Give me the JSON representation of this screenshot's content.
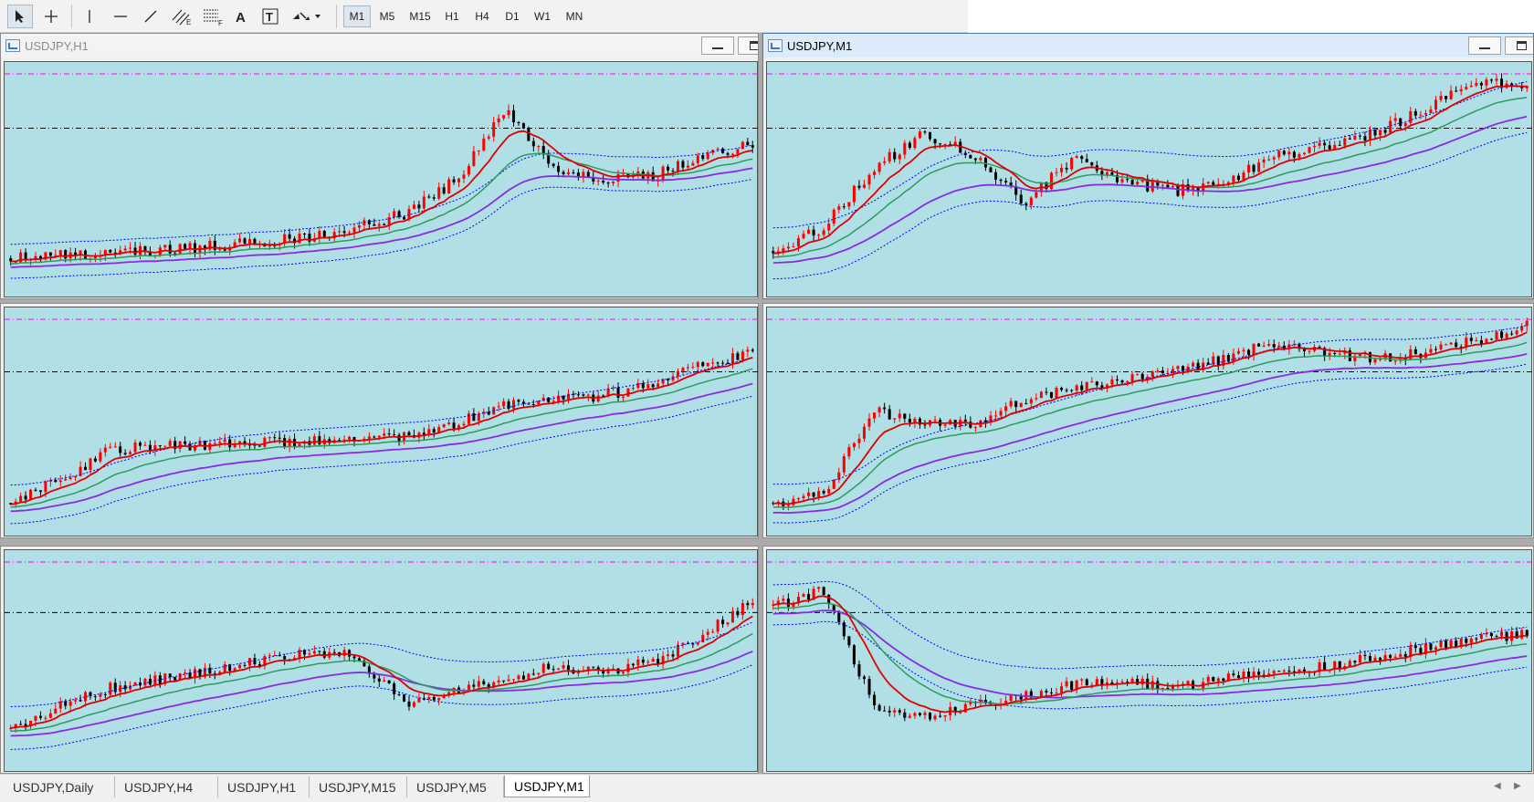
{
  "toolbar": {
    "tools": [
      {
        "name": "cursor-icon"
      },
      {
        "name": "crosshair-icon"
      },
      {
        "name": "vertical-line-icon"
      },
      {
        "name": "horizontal-line-icon"
      },
      {
        "name": "trendline-icon"
      },
      {
        "name": "equidistant-channel-icon",
        "label": "E"
      },
      {
        "name": "fibonacci-retracement-icon",
        "label": "F"
      },
      {
        "name": "text-tool-icon",
        "label": "A"
      },
      {
        "name": "text-label-icon",
        "label": "T"
      },
      {
        "name": "arrows-dropdown-icon"
      }
    ],
    "timeframes": [
      "M1",
      "M5",
      "M15",
      "H1",
      "H4",
      "D1",
      "W1",
      "MN"
    ],
    "active_timeframe": "M1"
  },
  "windows": [
    {
      "title": "USDJPY,H1",
      "active": false
    },
    {
      "title": "USDJPY,M1",
      "active": true
    }
  ],
  "tabs": [
    "USDJPY,Daily",
    "USDJPY,H4",
    "USDJPY,H1",
    "USDJPY,M15",
    "USDJPY,M5",
    "USDJPY,M1"
  ],
  "active_tab": "USDJPY,M1",
  "colors": {
    "chart_bg": "#b0e0e6",
    "bull_candle": "#ff0000",
    "bear_candle": "#000000",
    "ma_fast": "#e00000",
    "ma_mid": "#2e9a5c",
    "ma_slow": "#8a2be2",
    "bollinger": "#0000ff",
    "level_magenta": "#ff00ff",
    "level_black": "#000000"
  },
  "chart_data": [
    {
      "type": "candlestick",
      "name": "chart-top-left",
      "trend": [
        0.17,
        0.18,
        0.19,
        0.2,
        0.22,
        0.24,
        0.26,
        0.3,
        0.36,
        0.5,
        0.8,
        0.55,
        0.5,
        0.52,
        0.6,
        0.65
      ],
      "ma_lag": 0.05,
      "band_width": 0.12
    },
    {
      "type": "candlestick",
      "name": "chart-top-right",
      "trend": [
        0.2,
        0.3,
        0.55,
        0.7,
        0.6,
        0.4,
        0.6,
        0.5,
        0.45,
        0.5,
        0.6,
        0.65,
        0.7,
        0.8,
        0.92,
        0.9
      ],
      "ma_lag": 0.08,
      "band_width": 0.18
    },
    {
      "type": "candlestick",
      "name": "chart-middle-left",
      "trend": [
        0.15,
        0.25,
        0.38,
        0.4,
        0.4,
        0.41,
        0.42,
        0.42,
        0.44,
        0.5,
        0.58,
        0.6,
        0.62,
        0.66,
        0.75,
        0.8
      ],
      "ma_lag": 0.06,
      "band_width": 0.14
    },
    {
      "type": "candlestick",
      "name": "chart-middle-right",
      "trend": [
        0.15,
        0.18,
        0.55,
        0.5,
        0.5,
        0.6,
        0.65,
        0.68,
        0.72,
        0.78,
        0.85,
        0.8,
        0.78,
        0.8,
        0.86,
        0.92
      ],
      "ma_lag": 0.08,
      "band_width": 0.14
    },
    {
      "type": "candlestick",
      "name": "chart-bottom-left",
      "trend": [
        0.2,
        0.3,
        0.38,
        0.42,
        0.45,
        0.5,
        0.55,
        0.52,
        0.3,
        0.38,
        0.42,
        0.48,
        0.45,
        0.5,
        0.62,
        0.78
      ],
      "ma_lag": 0.07,
      "band_width": 0.16
    },
    {
      "type": "candlestick",
      "name": "chart-bottom-right",
      "trend": [
        0.75,
        0.82,
        0.3,
        0.25,
        0.3,
        0.34,
        0.4,
        0.42,
        0.38,
        0.42,
        0.45,
        0.48,
        0.52,
        0.56,
        0.6,
        0.62
      ],
      "ma_lag": 0.08,
      "band_width": 0.15
    }
  ]
}
